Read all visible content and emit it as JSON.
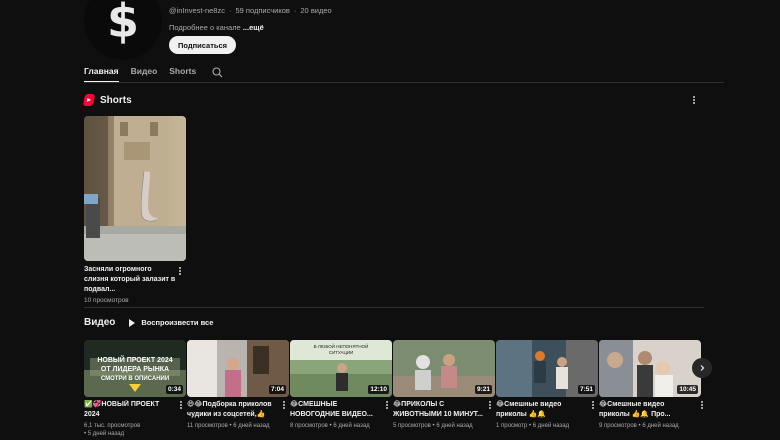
{
  "channel": {
    "avatar_glyph": "$",
    "handle": "@inInvest-ne8zc",
    "subscribers": "59 подписчиков",
    "videos_count": "20 видео",
    "meta_separator": "·",
    "description_prefix": "Подробнее о канале",
    "description_more": "...ещё",
    "subscribe_label": "Подписаться"
  },
  "tabs": [
    {
      "label": "Главная",
      "active": true
    },
    {
      "label": "Видео",
      "active": false
    },
    {
      "label": "Shorts",
      "active": false
    }
  ],
  "shorts_section": {
    "title": "Shorts",
    "items": [
      {
        "title": "Засняли огромного слизня который залазит в подвал...",
        "views": "10 просмотров"
      }
    ]
  },
  "videos_section": {
    "title": "Видео",
    "play_all_label": "Воспроизвести все",
    "thumbnail_texts": {
      "v1_lines": [
        "НОВЫЙ ПРОЕКТ 2024",
        "ОТ ЛИДЕРА РЫНКА",
        "СМОТРИ В ОПИСАНИИ"
      ],
      "v3_lines": [
        "В ЛЮБОЙ НЕПОНЯТНОЙ",
        "СИТУАЦИИ"
      ]
    },
    "items": [
      {
        "title": "✅💞НОВЫЙ ПРОЕКТ 2024",
        "duration": "0:34",
        "views": "6,1 тыс. просмотров",
        "age": "• 5 дней назад"
      },
      {
        "title": "😄😂Подборка приколов чудики из соцсетей,👍🔔...",
        "duration": "7:04",
        "views": "11 просмотров",
        "age": "• 6 дней назад"
      },
      {
        "title": "😂СМЕШНЫЕ НОВОГОДНИЕ ВИДЕО...",
        "duration": "12:10",
        "views": "8 просмотров",
        "age": "• 6 дней назад"
      },
      {
        "title": "😂ПРИКОЛЫ С ЖИВОТНЫМИ 10 МИНУТ...",
        "duration": "9:21",
        "views": "5 просмотров",
        "age": "• 6 дней назад"
      },
      {
        "title": "😂Смешные видео приколы 👍🔔 ПРИКОЛЫ...",
        "duration": "7:51",
        "views": "1 просмотр",
        "age": "• 6 дней назад"
      },
      {
        "title": "😂Смешные видео приколы 👍🔔 Про...",
        "duration": "10:45",
        "views": "9 просмотров",
        "age": "• 6 дней назад"
      }
    ]
  },
  "colors": {
    "background": "#0f0f0f",
    "text_primary": "#f1f1f1",
    "text_secondary": "#aaaaaa",
    "shorts_red": "#ff0033",
    "divider": "#303030"
  }
}
